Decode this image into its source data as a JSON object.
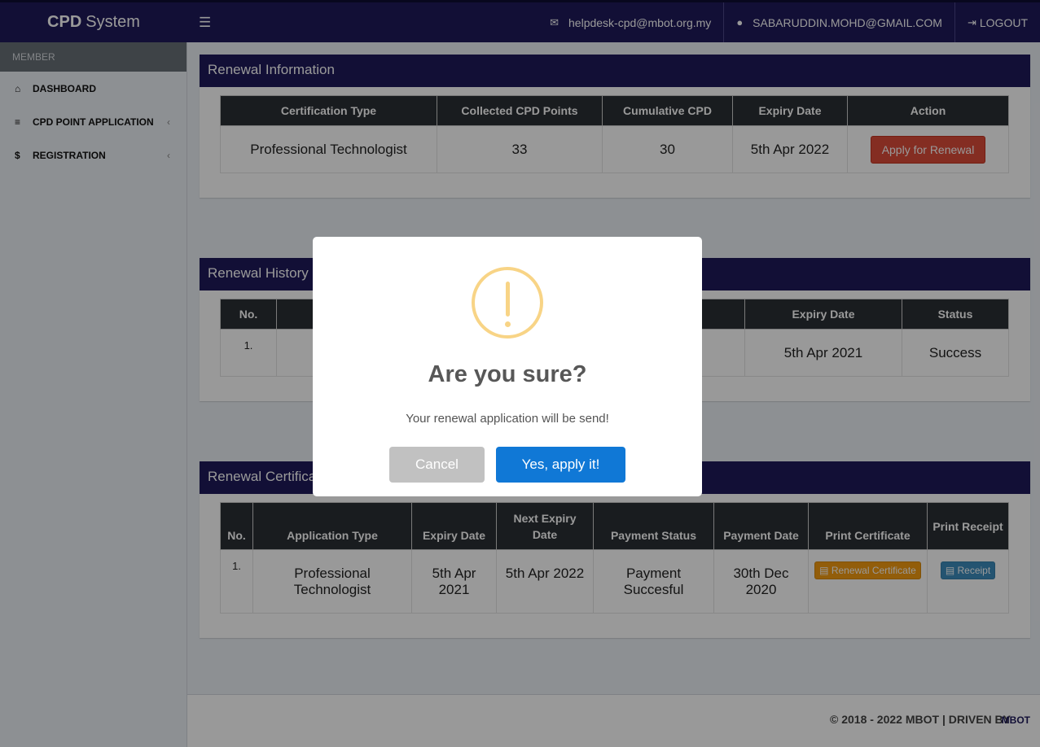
{
  "navbar": {
    "brand_bold": "CPD",
    "brand_rest": "System",
    "email": "helpdesk-cpd@mbot.org.my",
    "user": "SABARUDDIN.MOHD@GMAIL.COM",
    "logout": "LOGOUT",
    "icons": {
      "menu": "hamburger-icon",
      "mail": "envelope-icon",
      "user": "user-circle-icon",
      "logout": "sign-out-icon"
    }
  },
  "sidebar": {
    "header": "MEMBER",
    "items": [
      {
        "label": "DASHBOARD",
        "icon": "home-icon"
      },
      {
        "label": "CPD POINT APPLICATION",
        "icon": "list-icon"
      },
      {
        "label": "REGISTRATION",
        "icon": "dollar-icon"
      }
    ]
  },
  "renewal_info": {
    "title": "Renewal Information",
    "headers": [
      "Certification Type",
      "Collected CPD Points",
      "Cumulative CPD",
      "Expiry Date",
      "Action"
    ],
    "row": {
      "cert_type": "Professional Technologist",
      "collected": "33",
      "cumulative": "30",
      "expiry": "5th Apr 2022",
      "action": "Apply for Renewal"
    }
  },
  "renewal_history": {
    "title": "Renewal History",
    "headers": [
      "No.",
      "",
      "Expiry Date",
      "Status"
    ],
    "row": {
      "no": "1.",
      "expiry": "5th Apr 2021",
      "status": "Success"
    }
  },
  "renewal_cert": {
    "title": "Renewal Certificate",
    "headers": [
      "No.",
      "Application Type",
      "Expiry Date",
      "Next Expiry Date",
      "Payment Status",
      "Payment Date",
      "Print Certificate",
      "Print Receipt"
    ],
    "row": {
      "no": "1.",
      "app_type": "Professional Technologist",
      "expiry": "5th Apr 2021",
      "next_expiry": "5th Apr 2022",
      "payment_status": "Payment Succesful",
      "payment_date": "30th Dec 2020",
      "cert_btn": "Renewal Certificate",
      "receipt_btn": "Receipt"
    }
  },
  "footer": {
    "text": "© 2018 - 2022 MBOT | DRIVEN BY",
    "logo": "MBOT"
  },
  "modal": {
    "title": "Are you sure?",
    "text": "Your renewal application will be send!",
    "cancel": "Cancel",
    "confirm": "Yes, apply it!",
    "icon": "warning-icon"
  },
  "colors": {
    "navy": "#1e1a5a",
    "danger": "#dd4b39",
    "confirm": "#1078d6",
    "warning": "#f8d486"
  }
}
